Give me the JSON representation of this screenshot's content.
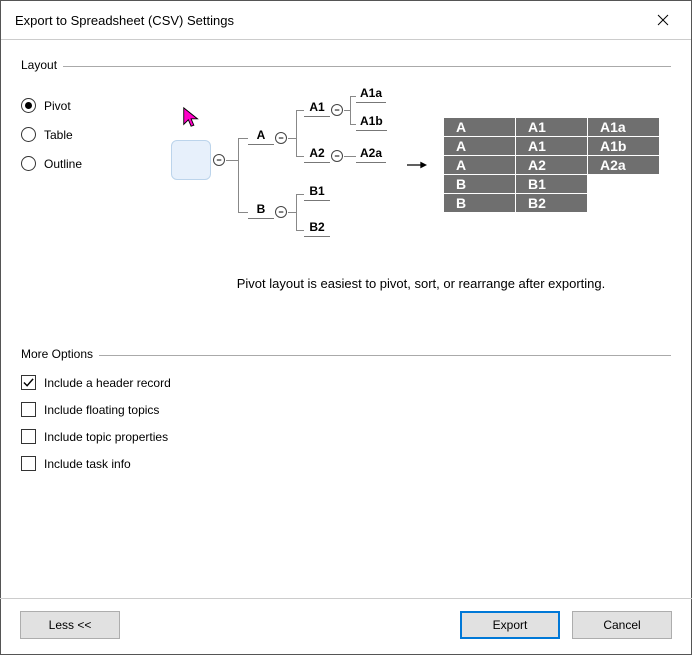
{
  "title": "Export to Spreadsheet (CSV) Settings",
  "section_layout": "Layout",
  "section_more": "More Options",
  "radios": {
    "pivot": "Pivot",
    "table": "Table",
    "outline": "Outline"
  },
  "diagram": {
    "A": "A",
    "B": "B",
    "A1": "A1",
    "A2": "A2",
    "B1": "B1",
    "B2": "B2",
    "A1a": "A1a",
    "A1b": "A1b",
    "A2a": "A2a"
  },
  "table_preview": [
    [
      "A",
      "A1",
      "A1a"
    ],
    [
      "A",
      "A1",
      "A1b"
    ],
    [
      "A",
      "A2",
      "A2a"
    ],
    [
      "B",
      "B1",
      ""
    ],
    [
      "B",
      "B2",
      ""
    ]
  ],
  "description": "Pivot layout is easiest to pivot, sort, or rearrange after exporting.",
  "checks": {
    "header": "Include a header record",
    "floating": "Include floating topics",
    "props": "Include topic properties",
    "task": "Include task info"
  },
  "buttons": {
    "less": "Less <<",
    "export": "Export",
    "cancel": "Cancel"
  }
}
